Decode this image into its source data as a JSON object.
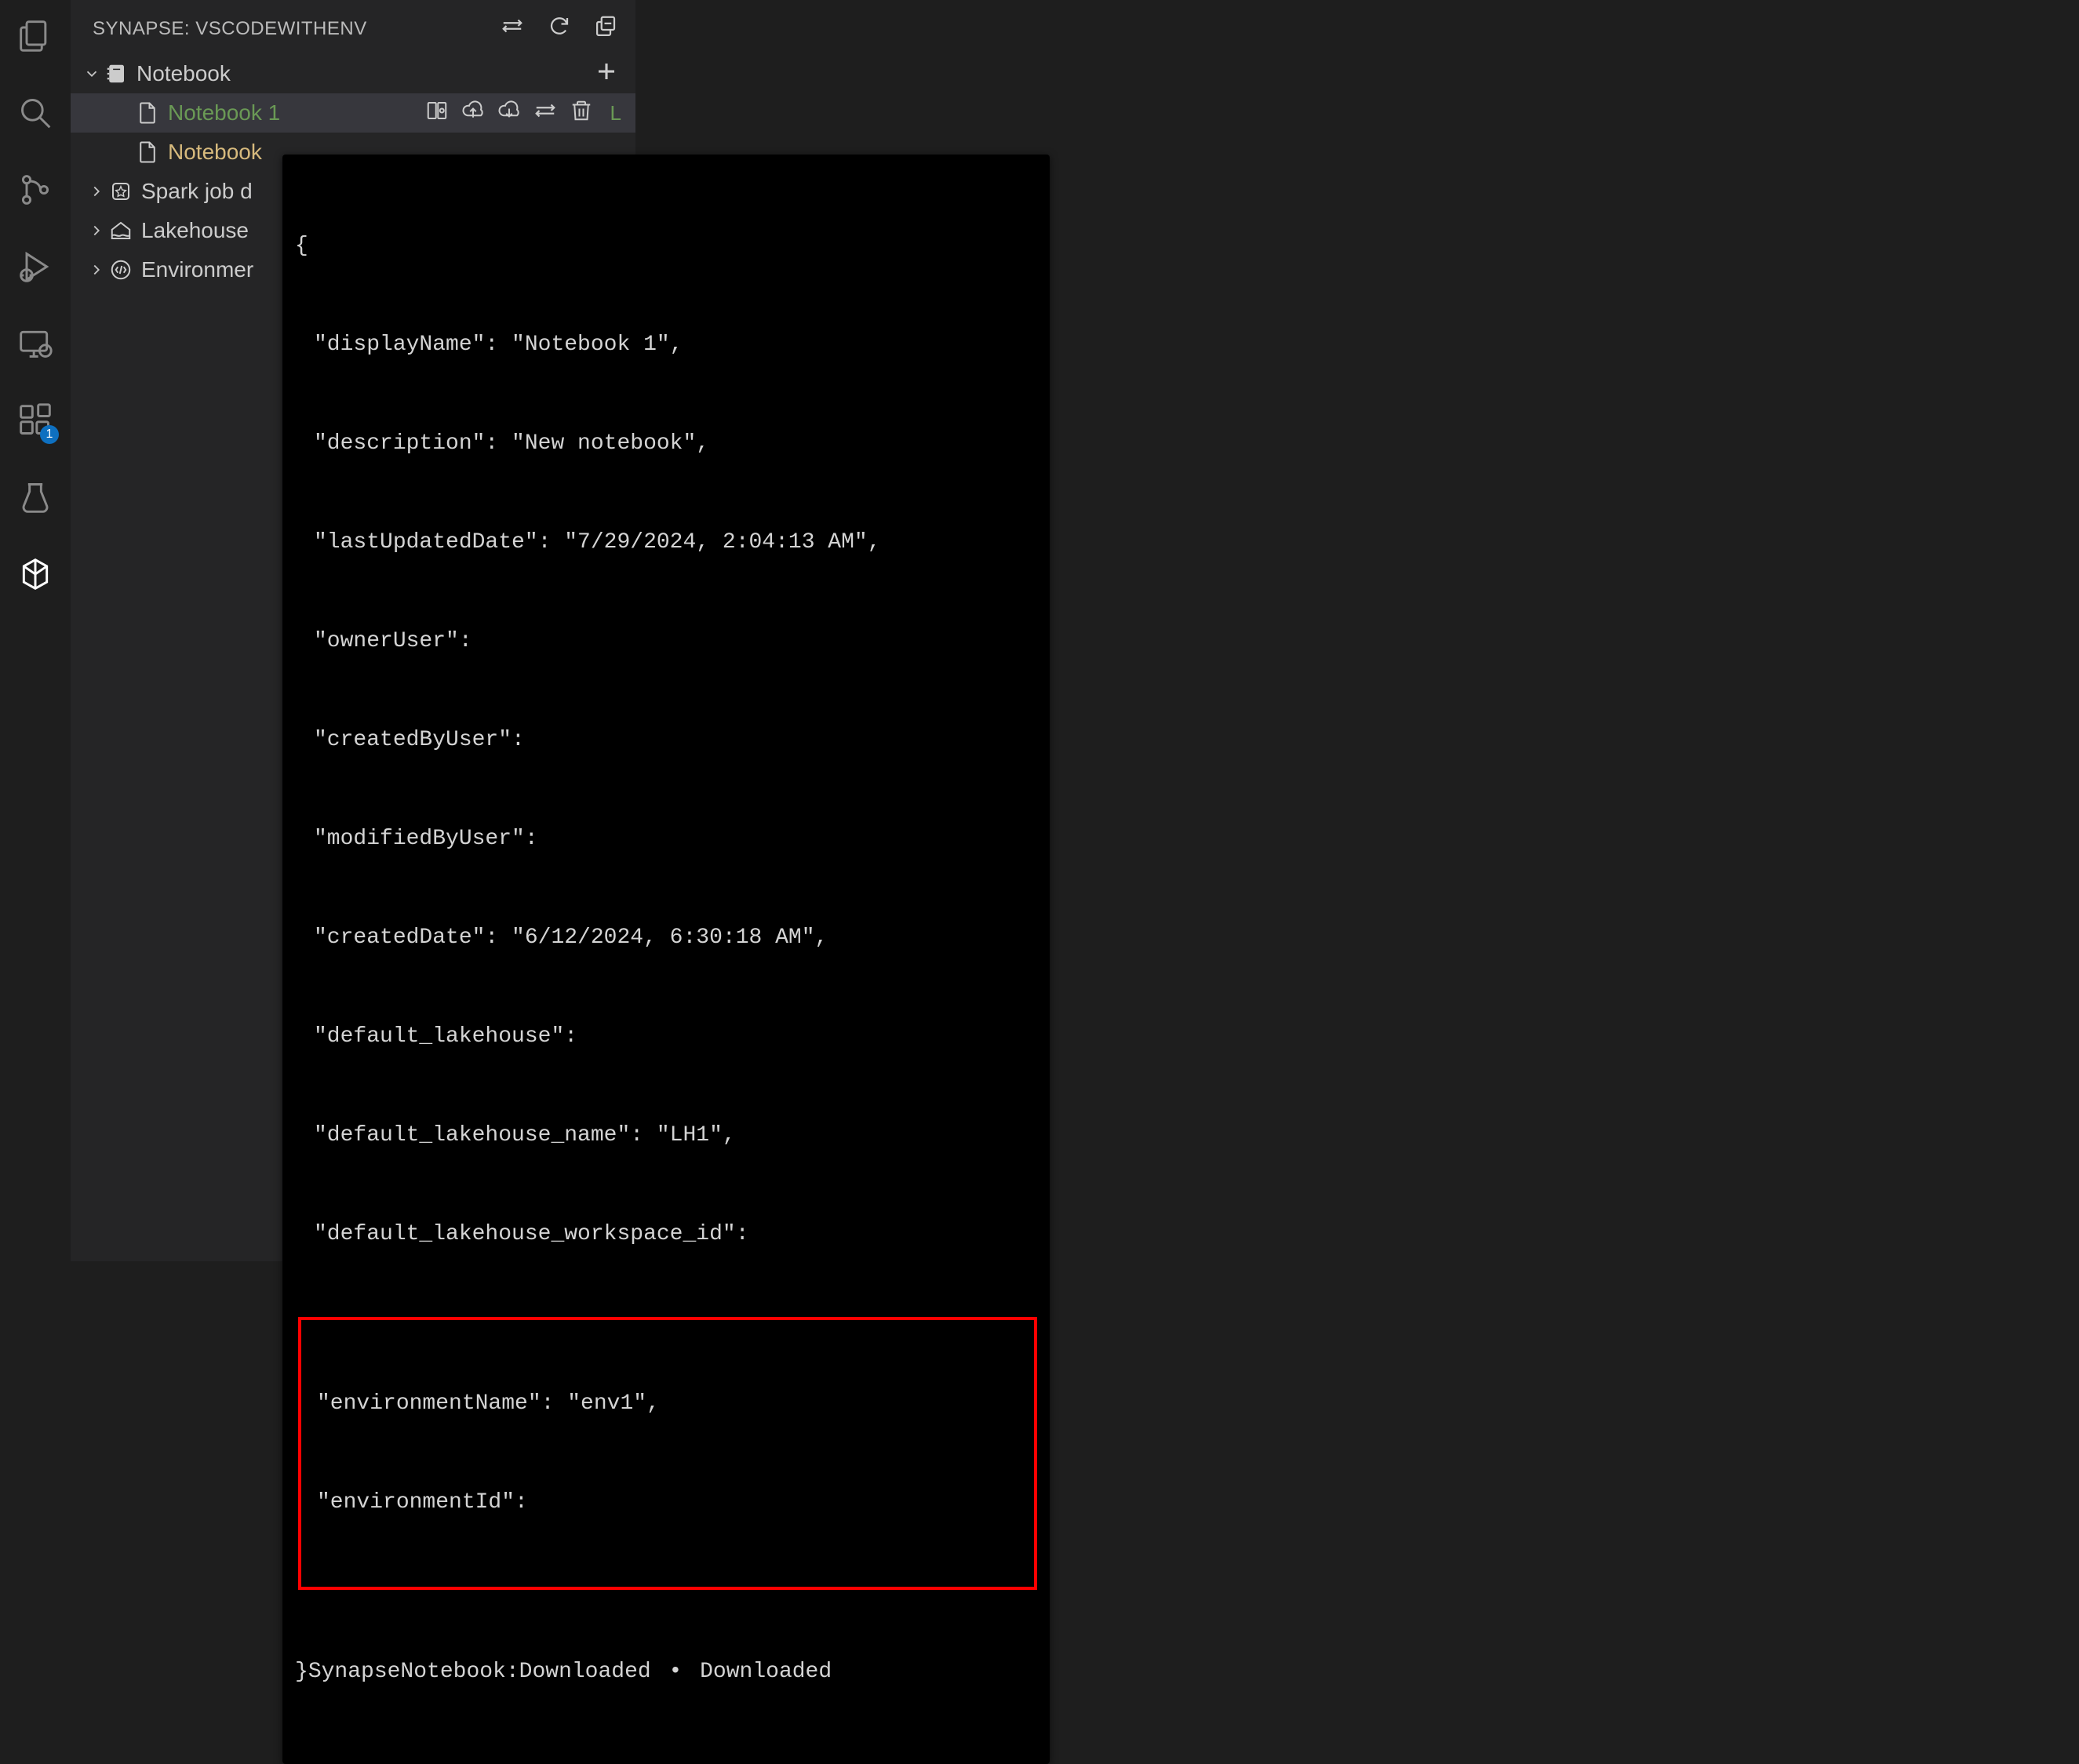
{
  "panel": {
    "title": "SYNAPSE: VSCODEWITHENV"
  },
  "tree": {
    "notebook_group": "Notebook",
    "notebook1": "Notebook 1",
    "notebook1_status": "L",
    "notebook2": "Notebook",
    "spark_group": "Spark job d",
    "lakehouse_group": "Lakehouse",
    "environment_group": "Environmer"
  },
  "tooltip": {
    "open": "{",
    "lines": [
      "\"displayName\": \"Notebook 1\",",
      "\"description\": \"New notebook\",",
      "\"lastUpdatedDate\": \"7/29/2024, 2:04:13 AM\",",
      "\"ownerUser\":",
      "\"createdByUser\":",
      "\"modifiedByUser\":",
      "\"createdDate\": \"6/12/2024, 6:30:18 AM\",",
      "\"default_lakehouse\":",
      "\"default_lakehouse_name\": \"LH1\",",
      "\"default_lakehouse_workspace_id\":"
    ],
    "highlighted": [
      "\"environmentName\": \"env1\",",
      "\"environmentId\":"
    ],
    "close_prefix": "}",
    "status_kind": "SynapseNotebook:Downloaded",
    "bullet": "•",
    "status_state": "Downloaded"
  },
  "badge": {
    "extensions": "1"
  }
}
